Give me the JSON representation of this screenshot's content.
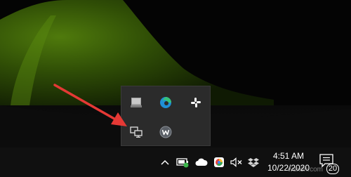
{
  "flyout": {
    "icons": [
      "monitor-tray-icon",
      "edge-icon",
      "slack-icon",
      "network-remote-icon",
      "w-app-icon"
    ]
  },
  "taskbar": {
    "icons": [
      "chevron-up-icon",
      "battery-tray-icon",
      "onedrive-icon",
      "browser-tray-icon",
      "volume-muted-icon",
      "dropbox-icon"
    ],
    "clock": {
      "time": "4:51 AM",
      "date": "10/22/2020"
    },
    "notifications": {
      "count": "20"
    }
  },
  "watermark": "wsxdn.com",
  "colors": {
    "arrow": "#e53935",
    "taskbar": "#101010",
    "flyout": "#2b2b2b",
    "wallpaper": "#0d1a05"
  }
}
